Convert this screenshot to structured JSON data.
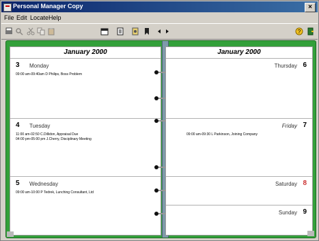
{
  "window": {
    "title": "Personal Manager Copy",
    "close_glyph": "×"
  },
  "menu": {
    "items": [
      "File",
      "Edit",
      "Locate",
      "Help"
    ]
  },
  "toolbar": {
    "buttons": [
      "print-icon",
      "find-icon",
      "cut-icon",
      "copy-icon",
      "paste-icon",
      "calendar-icon",
      "notebook-icon",
      "phonebook-icon",
      "bookmark-icon",
      "previous-icon",
      "next-icon",
      "help-icon",
      "exit-icon"
    ]
  },
  "left_page": {
    "month": "January 2000",
    "days": [
      {
        "num": "3",
        "name": "Monday",
        "entries": [
          "09:00 am-09:40am D Philips, Boss Problem"
        ]
      },
      {
        "num": "4",
        "name": "Tuesday",
        "entries": [
          "11:00 am-02:50 C.Dillidon, Appraisal Due",
          "04:00 pm-05:00 pm J.Cherry, Disciplinary Meeting"
        ]
      },
      {
        "num": "5",
        "name": "Wednesday",
        "entries": [
          "09:00 am-10:00 P Tedrek, Lunching Consultant, Ltd"
        ]
      }
    ]
  },
  "right_page": {
    "month": "January 2000",
    "days": [
      {
        "num": "6",
        "name": "Thursday",
        "entries": []
      },
      {
        "num": "7",
        "name": "Friday",
        "entries": [
          "09:00 am-09:30 L Parkinson, Joining Company"
        ]
      },
      {
        "num": "8",
        "name": "Saturday",
        "entries": []
      },
      {
        "num": "9",
        "name": "Sunday",
        "entries": []
      }
    ]
  },
  "colors": {
    "board": "#33a03a",
    "spine": "#7f9aaa",
    "titlebar": "#0a246a",
    "weekend_marker": "#cc3333"
  }
}
